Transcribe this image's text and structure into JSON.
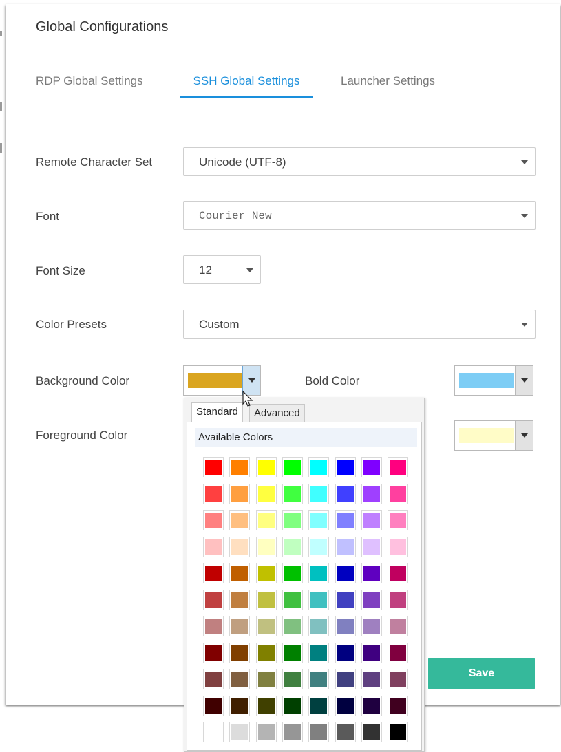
{
  "title": "Global Configurations",
  "tabs": [
    {
      "label": "RDP Global Settings",
      "active": false
    },
    {
      "label": "SSH Global Settings",
      "active": true
    },
    {
      "label": "Launcher Settings",
      "active": false
    }
  ],
  "form": {
    "charset_label": "Remote Character Set",
    "charset_value": "Unicode (UTF-8)",
    "font_label": "Font",
    "font_value": "Courier New",
    "fontsize_label": "Font Size",
    "fontsize_value": "12",
    "presets_label": "Color Presets",
    "presets_value": "Custom",
    "bg_label": "Background Color",
    "bg_color": "#daa520",
    "bold_label": "Bold Color",
    "bold_color": "#7dcdf5",
    "fg_label": "Foreground Color",
    "fg2_color": "#fffcc7"
  },
  "save_label": "Save",
  "color_picker": {
    "tabs": [
      "Standard",
      "Advanced"
    ],
    "active_tab": "Standard",
    "header": "Available Colors",
    "rows": [
      [
        "#ff0000",
        "#ff7f00",
        "#ffff00",
        "#00ff00",
        "#00ffff",
        "#0000ff",
        "#7f00ff",
        "#ff007f"
      ],
      [
        "#ff4040",
        "#ff9f40",
        "#ffff40",
        "#40ff40",
        "#40ffff",
        "#4040ff",
        "#9f40ff",
        "#ff409f"
      ],
      [
        "#ff8080",
        "#ffbf80",
        "#ffff80",
        "#80ff80",
        "#80ffff",
        "#8080ff",
        "#bf80ff",
        "#ff80bf"
      ],
      [
        "#ffc0c0",
        "#ffdfc0",
        "#ffffc0",
        "#c0ffc0",
        "#c0ffff",
        "#c0c0ff",
        "#dfc0ff",
        "#ffc0df"
      ],
      [
        "#c00000",
        "#c05f00",
        "#c0c000",
        "#00c000",
        "#00c0c0",
        "#0000c0",
        "#5f00c0",
        "#c0005f"
      ],
      [
        "#c04040",
        "#c07f40",
        "#c0c040",
        "#40c040",
        "#40c0c0",
        "#4040c0",
        "#7f40c0",
        "#c0407f"
      ],
      [
        "#c08080",
        "#c09f80",
        "#c0c080",
        "#80c080",
        "#80c0c0",
        "#8080c0",
        "#9f80c0",
        "#c0809f"
      ],
      [
        "#800000",
        "#803f00",
        "#808000",
        "#008000",
        "#008080",
        "#000080",
        "#3f0080",
        "#80003f"
      ],
      [
        "#804040",
        "#805f40",
        "#808040",
        "#408040",
        "#408080",
        "#404080",
        "#5f4080",
        "#80405f"
      ],
      [
        "#400000",
        "#401f00",
        "#404000",
        "#004000",
        "#004040",
        "#000040",
        "#1f0040",
        "#40001f"
      ],
      [
        "#ffffff",
        "#dcdcdc",
        "#b4b4b4",
        "#969696",
        "#808080",
        "#5a5a5a",
        "#323232",
        "#000000"
      ]
    ]
  }
}
